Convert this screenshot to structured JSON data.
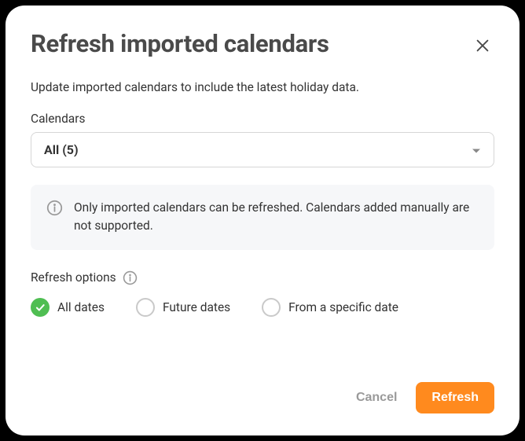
{
  "modal": {
    "title": "Refresh imported calendars",
    "description": "Update imported calendars to include the latest holiday data.",
    "calendars_label": "Calendars",
    "select_value": "All (5)",
    "info_text": "Only imported calendars can be refreshed. Calendars added manually are not supported.",
    "options_label": "Refresh options",
    "radios": [
      {
        "label": "All dates",
        "selected": true
      },
      {
        "label": "Future dates",
        "selected": false
      },
      {
        "label": "From a specific date",
        "selected": false
      }
    ],
    "cancel_label": "Cancel",
    "refresh_label": "Refresh"
  }
}
